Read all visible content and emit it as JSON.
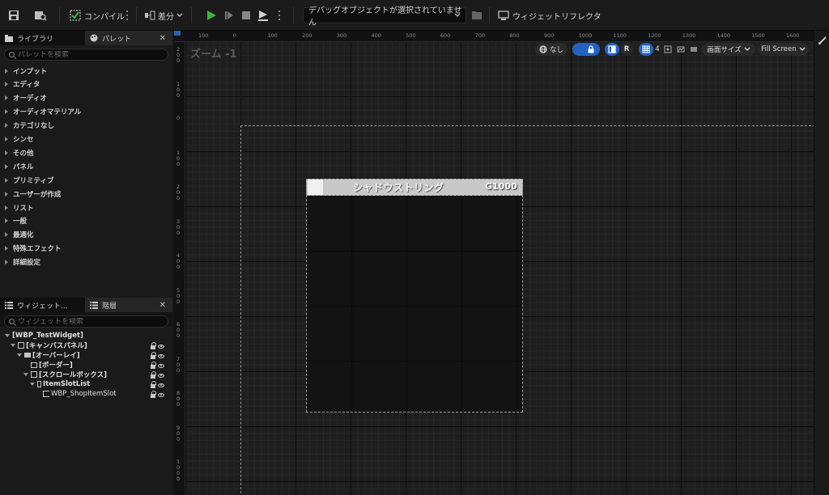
{
  "toolbar": {
    "compile_label": "コンパイル",
    "diff_label": "差分",
    "debug_object": "デバッグオブジェクトが選択されていません",
    "widget_reflector_label": "ウィジェットリフレクタ",
    "accent_play": "#3fb13f"
  },
  "palette_panel": {
    "tab_library": "ライブラリ",
    "tab_palette": "パレット",
    "search_placeholder": "パレットを検索",
    "categories": [
      "インプット",
      "エディタ",
      "オーディオ",
      "オーディオマテリアル",
      "カテゴリなし",
      "シンセ",
      "その他",
      "パネル",
      "プリミティブ",
      "ユーザーが作成",
      "リスト",
      "一般",
      "最適化",
      "特殊エフェクト",
      "詳細設定"
    ]
  },
  "hierarchy_panel": {
    "tab_widgets": "ウィジェット...",
    "tab_hierarchy": "階層",
    "search_placeholder": "ウィジェットを検索",
    "tree": [
      {
        "label": "[WBP_TestWidget]"
      },
      {
        "label": "[キャンバスパネル]"
      },
      {
        "label": "[オーバーレイ]"
      },
      {
        "label": "[ボーダー]"
      },
      {
        "label": "[スクロールボックス]"
      },
      {
        "label": "ItemSlotList"
      },
      {
        "label": "WBP_ShopItemSlot"
      }
    ]
  },
  "viewport": {
    "zoom_label": "ズーム -1",
    "none_label": "なし",
    "r_label": "R",
    "grid_size": "4",
    "screen_size_label": "画面サイズ",
    "fill_screen_label": "Fill Screen",
    "ruler_h": [
      "100",
      "0",
      "100",
      "200",
      "300",
      "400",
      "500",
      "600",
      "700",
      "800",
      "900",
      "1000",
      "1100",
      "1200",
      "1300",
      "1400",
      "1500",
      "1600"
    ],
    "ruler_v": [
      "2 0 0",
      "1 0 0",
      "0",
      "1 0 0",
      "2 0 0",
      "3 0 0",
      "4 0 0",
      "5 0 0",
      "6 0 0",
      "7 0 0",
      "8 0 0",
      "9 0 0",
      "1 0 0 0"
    ]
  },
  "widget_preview": {
    "title": "シャドウストリング",
    "gold": "G1000"
  }
}
